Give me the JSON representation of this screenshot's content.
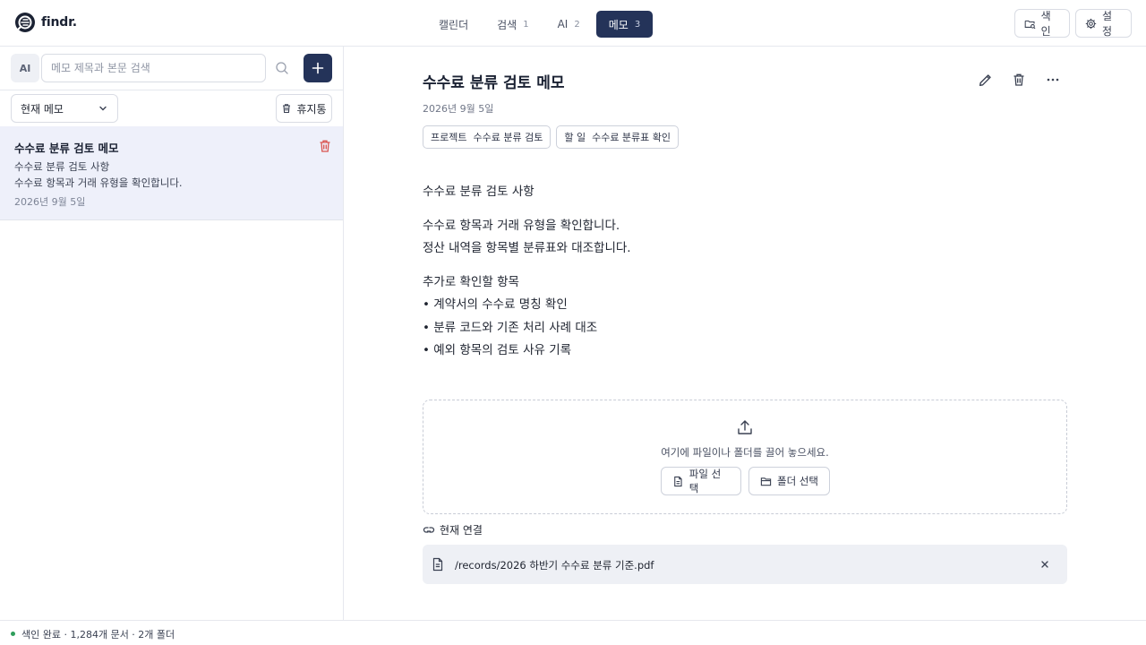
{
  "app": {
    "name": "findr."
  },
  "nav": {
    "tabs": [
      {
        "label": "캘린더",
        "count": ""
      },
      {
        "label": "검색",
        "count": "1"
      },
      {
        "label": "AI",
        "count": "2"
      },
      {
        "label": "메모",
        "count": "3",
        "active": true
      }
    ]
  },
  "header": {
    "index_label": "색인",
    "settings_label": "설정"
  },
  "sidebar": {
    "ai_label": "AI",
    "search_placeholder": "메모 제목과 본문 검색",
    "filter_label": "현재 메모",
    "trash_label": "휴지통",
    "memos": [
      {
        "title": "수수료 분류 검토 메모",
        "line1": "수수료 분류 검토 사항",
        "line2": "수수료 항목과 거래 유형을 확인합니다.",
        "date": "2026년 9월 5일"
      }
    ]
  },
  "doc": {
    "title": "수수료 분류 검토 메모",
    "date": "2026년 9월 5일",
    "tags": [
      {
        "key": "프로젝트",
        "value": "수수료 분류 검토"
      },
      {
        "key": "할 일",
        "value": "수수료 분류표 확인"
      }
    ],
    "body": [
      "수수료 분류 검토 사항",
      "수수료 항목과 거래 유형을 확인합니다.",
      "정산 내역을 항목별 분류표와 대조합니다.",
      "추가로 확인할 항목",
      "• 계약서의 수수료 명칭 확인",
      "• 분류 코드와 기존 처리 사례 대조",
      "• 예외 항목의 검토 사유 기록"
    ],
    "dropzone": {
      "text": "여기에 파일이나 폴더를 끌어 놓으세요.",
      "file_button": "파일 선택",
      "folder_button": "폴더 선택"
    },
    "connections": {
      "title": "현재 연결",
      "items": [
        {
          "path": "/records/2026 하반기 수수료 분류 기준.pdf"
        }
      ]
    }
  },
  "status": {
    "text": "색인 완료 · 1,284개 문서 · 2개 폴더",
    "color": "#2f9e5b"
  },
  "colors": {
    "accent": "#243359",
    "danger": "#d9534f"
  }
}
